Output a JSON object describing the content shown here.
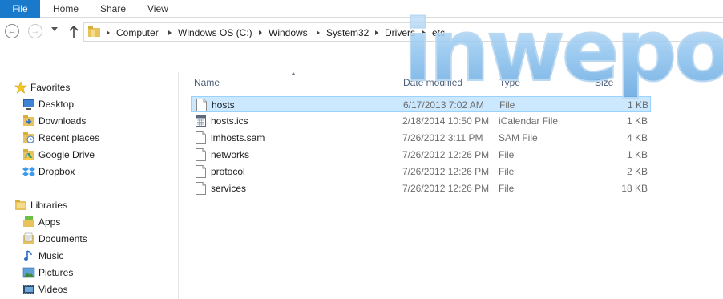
{
  "ribbon": {
    "tabs": [
      "File",
      "Home",
      "Share",
      "View"
    ]
  },
  "address": {
    "crumbs": [
      "Computer",
      "Windows OS (C:)",
      "Windows",
      "System32",
      "Drivers",
      "etc"
    ]
  },
  "nav": {
    "favorites_header": "Favorites",
    "favorites": [
      {
        "label": "Desktop",
        "icon": "desktop-icon"
      },
      {
        "label": "Downloads",
        "icon": "downloads-icon"
      },
      {
        "label": "Recent places",
        "icon": "recent-places-icon"
      },
      {
        "label": "Google Drive",
        "icon": "google-drive-icon"
      },
      {
        "label": "Dropbox",
        "icon": "dropbox-icon"
      }
    ],
    "libraries_header": "Libraries",
    "libraries": [
      {
        "label": "Apps",
        "icon": "apps-icon"
      },
      {
        "label": "Documents",
        "icon": "documents-icon"
      },
      {
        "label": "Music",
        "icon": "music-icon"
      },
      {
        "label": "Pictures",
        "icon": "pictures-icon"
      },
      {
        "label": "Videos",
        "icon": "videos-icon"
      }
    ]
  },
  "columns": {
    "name": "Name",
    "date": "Date modified",
    "type": "Type",
    "size": "Size"
  },
  "files": [
    {
      "name": "hosts",
      "date": "6/17/2013 7:02 AM",
      "type": "File",
      "size": "1 KB",
      "icon": "file-icon",
      "selected": true
    },
    {
      "name": "hosts.ics",
      "date": "2/18/2014 10:50 PM",
      "type": "iCalendar File",
      "size": "1 KB",
      "icon": "calendar-file-icon",
      "selected": false
    },
    {
      "name": "lmhosts.sam",
      "date": "7/26/2012 3:11 PM",
      "type": "SAM File",
      "size": "4 KB",
      "icon": "file-icon",
      "selected": false
    },
    {
      "name": "networks",
      "date": "7/26/2012 12:26 PM",
      "type": "File",
      "size": "1 KB",
      "icon": "file-icon",
      "selected": false
    },
    {
      "name": "protocol",
      "date": "7/26/2012 12:26 PM",
      "type": "File",
      "size": "2 KB",
      "icon": "file-icon",
      "selected": false
    },
    {
      "name": "services",
      "date": "7/26/2012 12:26 PM",
      "type": "File",
      "size": "18 KB",
      "icon": "file-icon",
      "selected": false
    }
  ],
  "watermark": {
    "text": "inwepo",
    "color": "#7fb6e6"
  },
  "colors": {
    "accent": "#1979ca",
    "selection_bg": "#cce8ff",
    "selection_border": "#99d1ff",
    "header_text": "#4c607a"
  }
}
